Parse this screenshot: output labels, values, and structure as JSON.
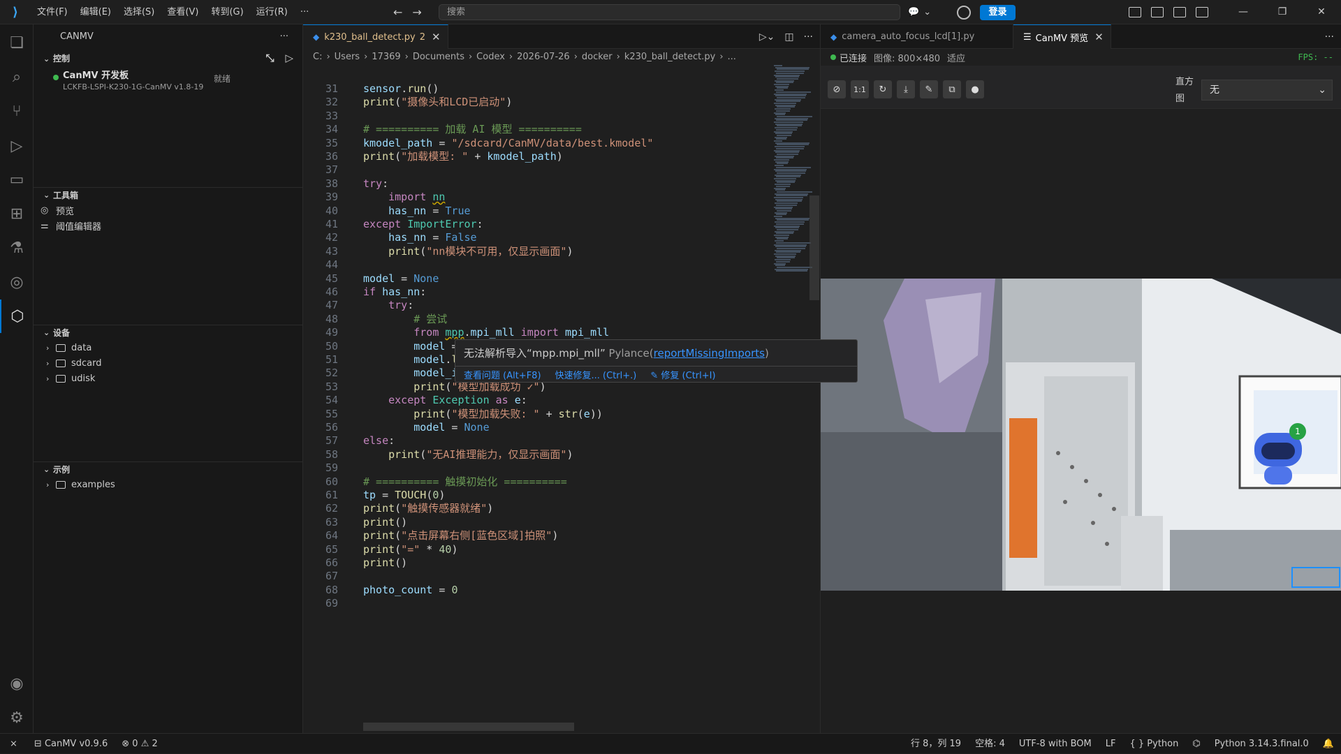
{
  "titlebar": {
    "menu": [
      "文件(F)",
      "编辑(E)",
      "选择(S)",
      "查看(V)",
      "转到(G)",
      "运行(R)",
      "···"
    ],
    "search_placeholder": "搜索",
    "login": "登录"
  },
  "sidebar": {
    "title": "CANMV",
    "control": {
      "header": "控制",
      "board_name": "CanMV 开发板",
      "board_id": "LCKFB-LSPI-K230-1G-CanMV v1.8-19",
      "board_status": "就绪"
    },
    "toolbox": {
      "header": "工具箱",
      "items": [
        "预览",
        "阈值编辑器"
      ]
    },
    "devices": {
      "header": "设备",
      "items": [
        "data",
        "sdcard",
        "udisk"
      ]
    },
    "examples": {
      "header": "示例",
      "items": [
        "examples"
      ]
    }
  },
  "editor": {
    "tab_label": "k230_ball_detect.py",
    "tab_dirty": "2",
    "breadcrumb": [
      "C:",
      "Users",
      "17369",
      "Documents",
      "Codex",
      "2026-07-26",
      "docker",
      "k230_ball_detect.py",
      "..."
    ],
    "lines": [
      {
        "n": "31",
        "code": "sensor.run()"
      },
      {
        "n": "32",
        "code": "print(\"摄像头和LCD已启动\")"
      },
      {
        "n": "33",
        "code": ""
      },
      {
        "n": "34",
        "code": "# ========== 加载 AI 模型 =========="
      },
      {
        "n": "35",
        "code": "kmodel_path = \"/sdcard/CanMV/data/best.kmodel\""
      },
      {
        "n": "36",
        "code": "print(\"加载模型: \" + kmodel_path)"
      },
      {
        "n": "37",
        "code": ""
      },
      {
        "n": "38",
        "code": "try:"
      },
      {
        "n": "39",
        "code": "    import nn"
      },
      {
        "n": "40",
        "code": "    has_nn = True"
      },
      {
        "n": "41",
        "code": "except ImportError:"
      },
      {
        "n": "42",
        "code": "    has_nn = False"
      },
      {
        "n": "43",
        "code": "    print(\"nn模块不可用，仅显示画面\")"
      },
      {
        "n": "44",
        "code": ""
      },
      {
        "n": "45",
        "code": "model = None"
      },
      {
        "n": "46",
        "code": "if has_nn:"
      },
      {
        "n": "47",
        "code": "    try:"
      },
      {
        "n": "48",
        "code": "        # 尝试"
      },
      {
        "n": "49",
        "code": "        from mpp.mpi_mll import mpi_mll"
      },
      {
        "n": "50",
        "code": "        model = mpi_mll.create()"
      },
      {
        "n": "51",
        "code": "        model.load(kmodel_path)"
      },
      {
        "n": "52",
        "code": "        model_input_size = [320, 320]  # YOLOv8 默认输入尺寸"
      },
      {
        "n": "53",
        "code": "        print(\"模型加载成功 ✓\")"
      },
      {
        "n": "54",
        "code": "    except Exception as e:"
      },
      {
        "n": "55",
        "code": "        print(\"模型加载失败: \" + str(e))"
      },
      {
        "n": "56",
        "code": "        model = None"
      },
      {
        "n": "57",
        "code": "else:"
      },
      {
        "n": "58",
        "code": "    print(\"无AI推理能力，仅显示画面\")"
      },
      {
        "n": "59",
        "code": ""
      },
      {
        "n": "60",
        "code": "# ========== 触摸初始化 =========="
      },
      {
        "n": "61",
        "code": "tp = TOUCH(0)"
      },
      {
        "n": "62",
        "code": "print(\"触摸传感器就绪\")"
      },
      {
        "n": "63",
        "code": "print()"
      },
      {
        "n": "64",
        "code": "print(\"点击屏幕右侧[蓝色区域]拍照\")"
      },
      {
        "n": "65",
        "code": "print(\"=\" * 40)"
      },
      {
        "n": "66",
        "code": "print()"
      },
      {
        "n": "67",
        "code": ""
      },
      {
        "n": "68",
        "code": "photo_count = 0"
      },
      {
        "n": "69",
        "code": ""
      }
    ],
    "hover": {
      "message": "无法解析导入“mpp.mpi_mll”",
      "source": "Pylance(",
      "code": "reportMissingImports",
      "close_paren": ")",
      "actions": [
        "查看问题 (Alt+F8)",
        "快速修复... (Ctrl+.)",
        "修复 (Ctrl+I)"
      ]
    }
  },
  "preview": {
    "tab_inactive": "camera_auto_focus_lcd[1].py",
    "tab_active": "CanMV 预览",
    "connected": "已连接",
    "image_info": "图像: 800×480",
    "fit": "适应",
    "fps": "FPS: --",
    "toolbar": {
      "zoom_label": "1:1",
      "histogram_label": "直方图",
      "histogram_value": "无"
    },
    "badge": "1"
  },
  "statusbar": {
    "canmv": "CanMV v0.9.6",
    "errors": "0",
    "warnings": "2",
    "position": "行 8，列 19",
    "spaces": "空格: 4",
    "encoding": "UTF-8 with BOM",
    "eol": "LF",
    "language": "{ } Python",
    "interpreter": "Python 3.14.3.final.0"
  },
  "colors": {
    "accent": "#0078d4",
    "connected": "#3fb950"
  }
}
